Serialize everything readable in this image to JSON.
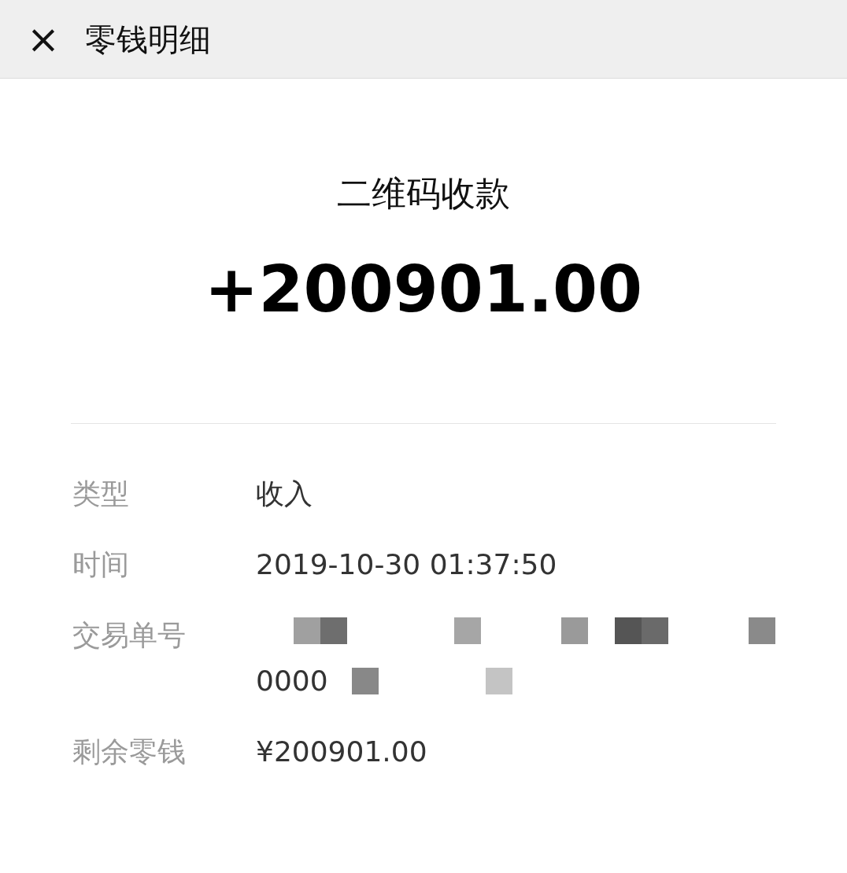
{
  "header": {
    "close_icon": "×",
    "title": "零钱明细"
  },
  "summary": {
    "title": "二维码收款",
    "amount": "+200901.00"
  },
  "details": [
    {
      "kind": "text",
      "label": "类型",
      "value": "收入"
    },
    {
      "kind": "text",
      "label": "时间",
      "value": "2019-10-30 01:37:50"
    },
    {
      "kind": "redacted",
      "label": "交易单号",
      "value": "0000"
    },
    {
      "kind": "text",
      "label": "剩余零钱",
      "value": "¥200901.00"
    }
  ]
}
